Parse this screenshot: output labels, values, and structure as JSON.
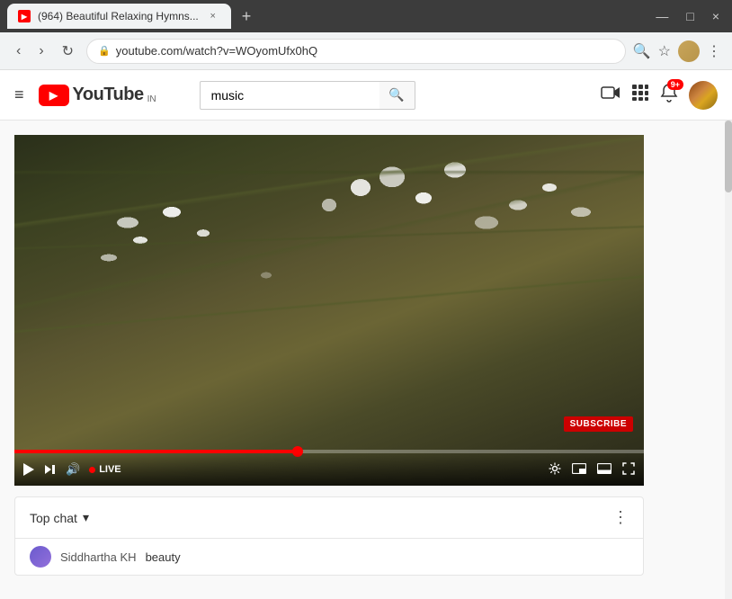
{
  "browser": {
    "tab": {
      "favicon": "▶",
      "title": "(964) Beautiful Relaxing Hymns...",
      "close_label": "×"
    },
    "new_tab_label": "+",
    "window_controls": {
      "minimize": "—",
      "maximize": "□",
      "close": "×"
    },
    "addressbar": {
      "back_label": "‹",
      "forward_label": "›",
      "reload_label": "↻",
      "url": "youtube.com/watch?v=WOyomUfx0hQ",
      "lock_icon": "🔒",
      "search_icon": "🔍",
      "star_icon": "☆",
      "menu_icon": "⋮"
    }
  },
  "youtube": {
    "logo": {
      "icon_text": "▶",
      "title": "YouTube",
      "country": "IN"
    },
    "search": {
      "value": "music",
      "placeholder": "Search",
      "button_icon": "🔍"
    },
    "header_actions": {
      "upload_icon": "📹",
      "apps_icon": "⋮⋮⋮",
      "notification_icon": "🔔",
      "notification_badge": "9+",
      "avatar_letter": ""
    },
    "menu_icon": "≡"
  },
  "video": {
    "subscribe_label": "SUBSCRIBE",
    "progress_percent": 45,
    "controls": {
      "play_label": "Play",
      "skip_label": "Skip",
      "volume_label": "Volume",
      "live_label": "LIVE",
      "settings_label": "Settings",
      "miniplayer_label": "Miniplayer",
      "theatre_label": "Theatre mode",
      "fullscreen_label": "Fullscreen"
    }
  },
  "chat": {
    "title": "Top chat",
    "dropdown_icon": "▾",
    "menu_icon": "⋮",
    "messages": [
      {
        "author": "Siddhartha KH",
        "text": "beauty"
      }
    ]
  }
}
